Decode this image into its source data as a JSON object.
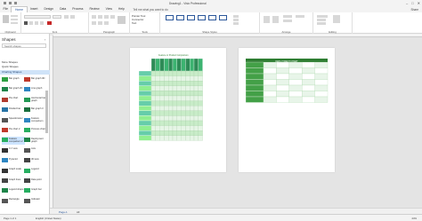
{
  "window": {
    "title": "Drawing1 - Visio Professional"
  },
  "ribbon_tabs": [
    "File",
    "Home",
    "Insert",
    "Design",
    "Data",
    "Process",
    "Review",
    "View",
    "Help"
  ],
  "active_tab": "Home",
  "tell_me": "Tell me what you want to do",
  "share_label": "Share",
  "ribbon_groups": [
    {
      "key": "clipboard",
      "label": "Clipboard"
    },
    {
      "key": "font",
      "label": "Font"
    },
    {
      "key": "paragraph",
      "label": "Paragraph"
    },
    {
      "key": "tools",
      "label": "Tools"
    },
    {
      "key": "shape_styles",
      "label": "Shape Styles"
    },
    {
      "key": "arrange",
      "label": "Arrange"
    },
    {
      "key": "editing",
      "label": "Editing"
    }
  ],
  "tools": {
    "pointer": "Pointer Tool",
    "connector": "Connector",
    "text": "Text"
  },
  "sidebar": {
    "title": "Shapes",
    "search_placeholder": "Search shapes",
    "links": [
      "More Shapes",
      "Quick Shapes"
    ],
    "selected_stencil": "Charting Shapes",
    "items": [
      {
        "label": "Bar graph",
        "color": "#2ea043"
      },
      {
        "label": "Bar graph 3D",
        "color": "#c0392b"
      },
      {
        "label": "Bar graph 2D",
        "color": "#1e8449"
      },
      {
        "label": "Line graph",
        "color": "#2e86c1"
      },
      {
        "label": "Pie chart",
        "color": "#b03a2e"
      },
      {
        "label": "Horizontal bar graph",
        "color": "#229954"
      },
      {
        "label": "Divided bar",
        "color": "#2874a6"
      },
      {
        "label": "Bar graph 3",
        "color": "#196f3d"
      },
      {
        "label": "Speedometer",
        "color": "#555555"
      },
      {
        "label": "Feature comparison",
        "color": "#2e86c1"
      },
      {
        "label": "Pie chart 2",
        "color": "#c0392b"
      },
      {
        "label": "Process chart",
        "color": "#27ae60"
      },
      {
        "label": "Feature comparison 2",
        "color": "#27ae60"
      },
      {
        "label": "Deployment graph",
        "color": "#1e8449"
      },
      {
        "label": "X-Y axis",
        "color": "#333333"
      },
      {
        "label": "Axis",
        "color": "#555555"
      },
      {
        "label": "Pyramid",
        "color": "#2e86c1"
      },
      {
        "label": "3D axis",
        "color": "#444444"
      },
      {
        "label": "Graph scale",
        "color": "#333333"
      },
      {
        "label": "Legend",
        "color": "#27ae60"
      },
      {
        "label": "Graph lines",
        "color": "#444444"
      },
      {
        "label": "Data point",
        "color": "#444444"
      },
      {
        "label": "Legend shape",
        "color": "#1e8449"
      },
      {
        "label": "Graph bar",
        "color": "#27ae60"
      },
      {
        "label": "Rectangle",
        "color": "#555555"
      },
      {
        "label": "Indicator",
        "color": "#555555"
      }
    ]
  },
  "page1": {
    "title": "Feature or Product Comparison"
  },
  "page2": {
    "header": "DEPLOYMENT CHART"
  },
  "statusbar": {
    "page": "Page 1 of 1",
    "english": "English (United States)",
    "zoom": "44%"
  },
  "page_tab": "Page-1",
  "page_all": "All"
}
